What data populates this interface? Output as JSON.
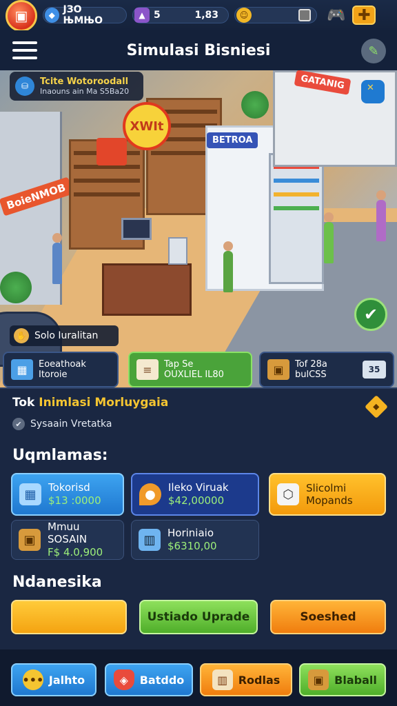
{
  "status_bar": {
    "resource_1": "ЈЗО ЊМЊО",
    "resource_2": "5",
    "resource_3": "1,83"
  },
  "header": {
    "title": "Simulasi Bisniesi"
  },
  "scene": {
    "overlay_title": "Tcite Wotoroodall",
    "overlay_subtitle": "Inaouns ain Ma S5Ba20",
    "store_sign_1": "XWIt",
    "store_sign_2": "BETROA",
    "store_sign_left": "BoieNMOB",
    "store_sign_right": "GATANIG",
    "status_pill": "Solo Iuralitan",
    "tabs": [
      {
        "line1": "Eoeathoak",
        "line2": "Itoroie"
      },
      {
        "line1": "Tap Se",
        "line2": "OUXLIEL IL80"
      },
      {
        "line1": "Tof 28a",
        "line2": "bulCSS"
      }
    ],
    "calc_label": "35"
  },
  "panel": {
    "title_prefix": "Tok ",
    "title_highlight": "Inimlasi Morluygaia",
    "subtitle": "Sysaain Vretatka",
    "section_1": "Uqmlamas:",
    "cards": [
      {
        "name": "Tokorisd",
        "value": "$13 :0000"
      },
      {
        "name": "Ileko Viruak",
        "value": "$42,00000"
      },
      {
        "name": "Slicolmi",
        "value": "Mopands"
      },
      {
        "name": "Mmuu SOSAIN",
        "value": "F$ 4.0,900"
      },
      {
        "name": "Horiniaio",
        "value": "$6310,00"
      }
    ],
    "section_2": "Ndanesika",
    "buttons": [
      "",
      "Ustiado Uprade",
      "Soeshed"
    ]
  },
  "bottom_nav": [
    "Jalhto",
    "Batddo",
    "Rodlas",
    "Blaball"
  ]
}
